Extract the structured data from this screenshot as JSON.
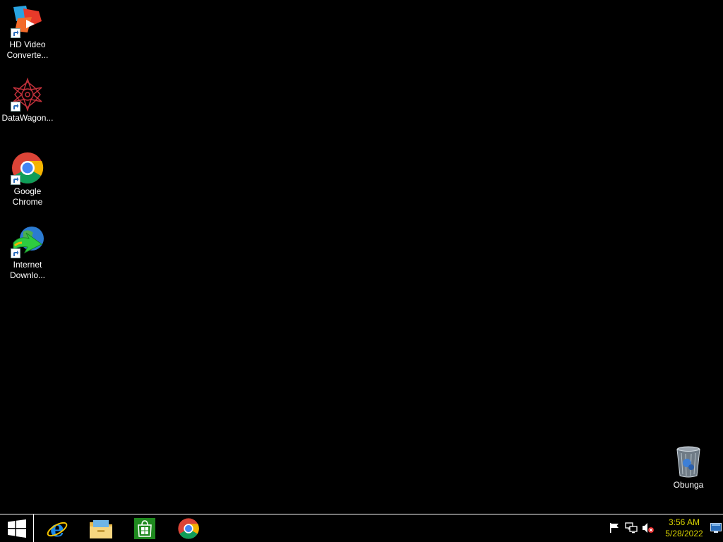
{
  "desktop": {
    "icons": [
      {
        "label": "HD Video\nConverte...",
        "icon": "hd-video-converter-icon"
      },
      {
        "label": "DataWagon...",
        "icon": "datawagon-icon"
      },
      {
        "label": "Google\nChrome",
        "icon": "chrome-icon"
      },
      {
        "label": "Internet\nDownlo...",
        "icon": "internet-download-manager-icon"
      }
    ],
    "recycle_bin": {
      "label": "Obunga",
      "icon": "recycle-bin-icon"
    }
  },
  "taskbar": {
    "start": {
      "icon": "windows-logo-icon"
    },
    "pinned": [
      {
        "icon": "internet-explorer-icon"
      },
      {
        "icon": "file-explorer-icon"
      },
      {
        "icon": "store-icon"
      },
      {
        "icon": "chrome-icon"
      }
    ],
    "tray": [
      {
        "icon": "action-center-flag-icon"
      },
      {
        "icon": "network-icon"
      },
      {
        "icon": "volume-muted-icon"
      }
    ],
    "clock": {
      "time": "3:56 AM",
      "date": "5/28/2022"
    },
    "colors": {
      "clock_text": "#d9d300",
      "border": "#ffffff",
      "background": "#000000"
    }
  }
}
